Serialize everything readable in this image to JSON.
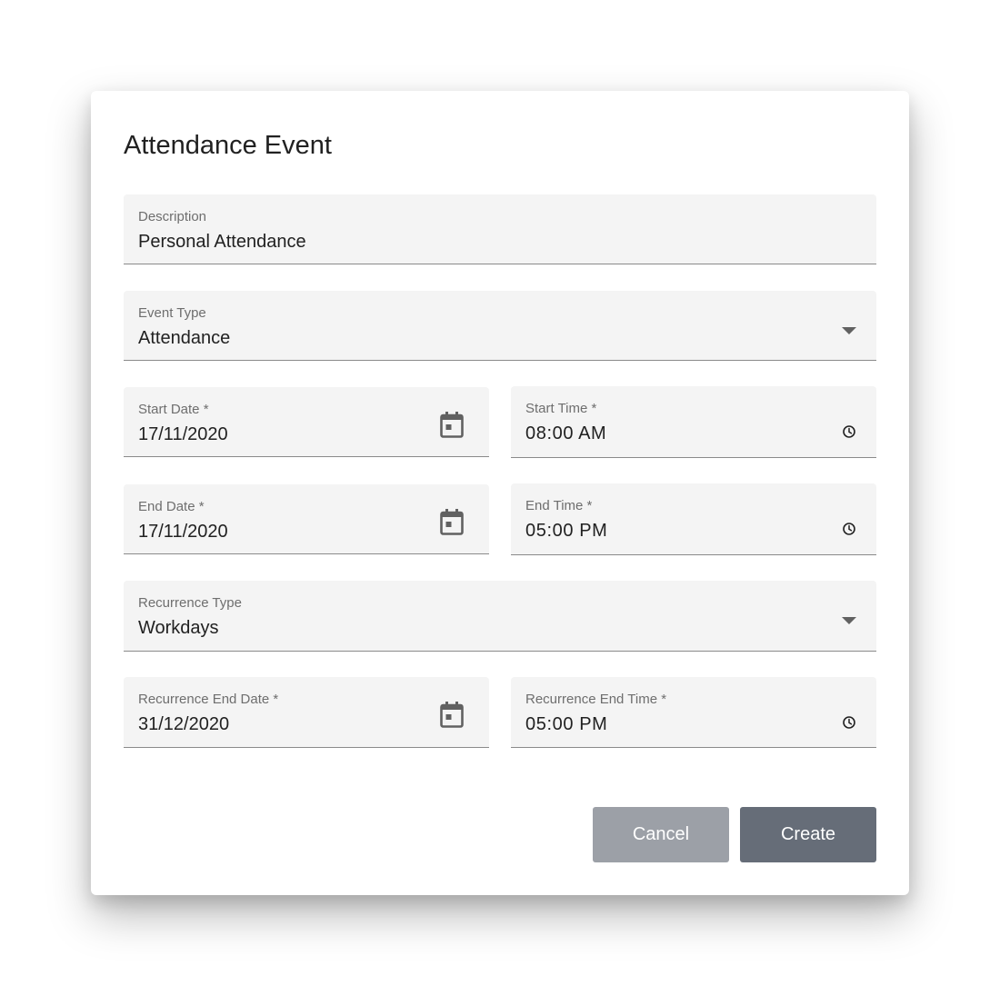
{
  "dialog": {
    "title": "Attendance Event"
  },
  "fields": {
    "description": {
      "label": "Description",
      "value": "Personal Attendance"
    },
    "event_type": {
      "label": "Event Type",
      "value": "Attendance"
    },
    "start_date": {
      "label": "Start Date *",
      "value": "17/11/2020"
    },
    "start_time": {
      "label": "Start Time *",
      "value": "08:00 AM"
    },
    "end_date": {
      "label": "End Date *",
      "value": "17/11/2020"
    },
    "end_time": {
      "label": "End Time *",
      "value": "05:00 PM"
    },
    "recurrence_type": {
      "label": "Recurrence Type",
      "value": "Workdays"
    },
    "recurrence_end_date": {
      "label": "Recurrence End Date *",
      "value": "31/12/2020"
    },
    "recurrence_end_time": {
      "label": "Recurrence End Time *",
      "value": "05:00 PM"
    }
  },
  "buttons": {
    "cancel": "Cancel",
    "create": "Create"
  },
  "icons": {
    "calendar": "calendar-icon",
    "clock": "clock-icon",
    "dropdown": "chevron-down-icon"
  },
  "colors": {
    "field_bg": "#f4f4f4",
    "cancel_bg": "#9ca0a7",
    "create_bg": "#666d78",
    "icon": "#616161"
  }
}
